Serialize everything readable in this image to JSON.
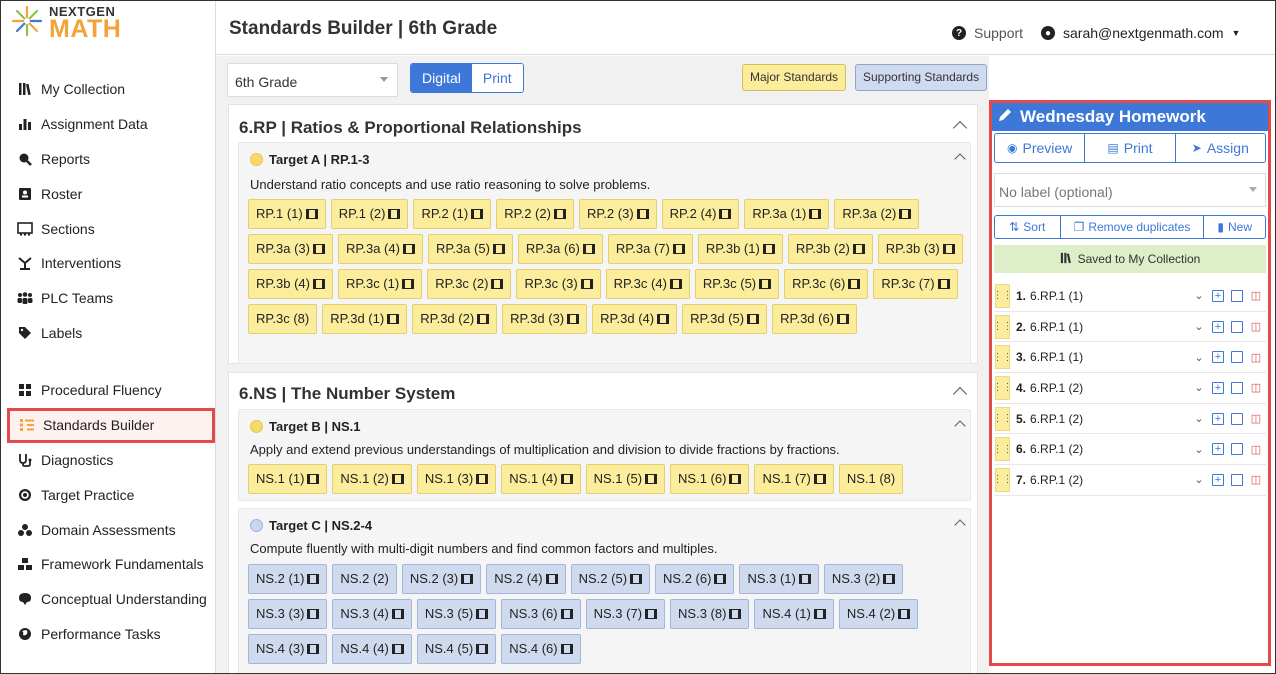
{
  "logo": {
    "line1": "NEXTGEN",
    "line2": "MATH"
  },
  "sidebar": {
    "items": [
      {
        "label": "My Collection",
        "icon": "collection-icon"
      },
      {
        "label": "Assignment Data",
        "icon": "bar-chart-icon"
      },
      {
        "label": "Reports",
        "icon": "search-report-icon"
      },
      {
        "label": "Roster",
        "icon": "roster-icon"
      },
      {
        "label": "Sections",
        "icon": "sections-icon"
      },
      {
        "label": "Interventions",
        "icon": "interventions-icon"
      },
      {
        "label": "PLC Teams",
        "icon": "users-icon"
      },
      {
        "label": "Labels",
        "icon": "tag-icon"
      }
    ],
    "items2": [
      {
        "label": "Procedural Fluency",
        "icon": "grid-icon"
      },
      {
        "label": "Standards Builder",
        "icon": "builder-icon",
        "active": true
      },
      {
        "label": "Diagnostics",
        "icon": "diagnostics-icon"
      },
      {
        "label": "Target Practice",
        "icon": "target-icon"
      },
      {
        "label": "Domain Assessments",
        "icon": "domain-icon"
      },
      {
        "label": "Framework Fundamentals",
        "icon": "framework-icon"
      },
      {
        "label": "Conceptual Understanding",
        "icon": "brain-icon"
      },
      {
        "label": "Performance Tasks",
        "icon": "globe-icon"
      }
    ]
  },
  "header": {
    "title": "Standards Builder | 6th Grade",
    "support": "Support",
    "user": "sarah@nextgenmath.com"
  },
  "toolbar": {
    "grade": "6th Grade",
    "mode_digital": "Digital",
    "mode_print": "Print",
    "legend_major": "Major Standards",
    "legend_supporting": "Supporting Standards"
  },
  "domains": [
    {
      "title": "6.RP | Ratios & Proportional Relationships",
      "targets": [
        {
          "head": "Target A | RP.1-3",
          "type": "major",
          "desc": "Understand ratio concepts and use ratio reasoning to solve problems.",
          "chips": [
            {
              "t": "RP.1 (1)",
              "v": true
            },
            {
              "t": "RP.1 (2)",
              "v": true
            },
            {
              "t": "RP.2 (1)",
              "v": true
            },
            {
              "t": "RP.2 (2)",
              "v": true
            },
            {
              "t": "RP.2 (3)",
              "v": true
            },
            {
              "t": "RP.2 (4)",
              "v": true
            },
            {
              "t": "RP.3a (1)",
              "v": true
            },
            {
              "t": "RP.3a (2)",
              "v": true
            },
            {
              "t": "RP.3a (3)",
              "v": true
            },
            {
              "t": "RP.3a (4)",
              "v": true
            },
            {
              "t": "RP.3a (5)",
              "v": true
            },
            {
              "t": "RP.3a (6)",
              "v": true
            },
            {
              "t": "RP.3a (7)",
              "v": true
            },
            {
              "t": "RP.3b (1)",
              "v": true
            },
            {
              "t": "RP.3b (2)",
              "v": true
            },
            {
              "t": "RP.3b (3)",
              "v": true
            },
            {
              "t": "RP.3b (4)",
              "v": true
            },
            {
              "t": "RP.3c (1)",
              "v": true
            },
            {
              "t": "RP.3c (2)",
              "v": true
            },
            {
              "t": "RP.3c (3)",
              "v": true
            },
            {
              "t": "RP.3c (4)",
              "v": true
            },
            {
              "t": "RP.3c (5)",
              "v": true
            },
            {
              "t": "RP.3c (6)",
              "v": true
            },
            {
              "t": "RP.3c (7)",
              "v": true
            },
            {
              "t": "RP.3c (8)",
              "v": false
            },
            {
              "t": "RP.3d (1)",
              "v": true
            },
            {
              "t": "RP.3d (2)",
              "v": true
            },
            {
              "t": "RP.3d (3)",
              "v": true
            },
            {
              "t": "RP.3d (4)",
              "v": true
            },
            {
              "t": "RP.3d (5)",
              "v": true
            },
            {
              "t": "RP.3d (6)",
              "v": true
            }
          ]
        }
      ]
    },
    {
      "title": "6.NS | The Number System",
      "targets": [
        {
          "head": "Target B | NS.1",
          "type": "major",
          "desc": "Apply and extend previous understandings of multiplication and division to divide fractions by fractions.",
          "chips": [
            {
              "t": "NS.1 (1)",
              "v": true
            },
            {
              "t": "NS.1 (2)",
              "v": true
            },
            {
              "t": "NS.1 (3)",
              "v": true
            },
            {
              "t": "NS.1 (4)",
              "v": true
            },
            {
              "t": "NS.1 (5)",
              "v": true
            },
            {
              "t": "NS.1 (6)",
              "v": true
            },
            {
              "t": "NS.1 (7)",
              "v": true
            },
            {
              "t": "NS.1 (8)",
              "v": false
            }
          ]
        },
        {
          "head": "Target C | NS.2-4",
          "type": "support",
          "desc": "Compute fluently with multi-digit numbers and find common factors and multiples.",
          "chips": [
            {
              "t": "NS.2 (1)",
              "v": true
            },
            {
              "t": "NS.2 (2)",
              "v": false
            },
            {
              "t": "NS.2 (3)",
              "v": true
            },
            {
              "t": "NS.2 (4)",
              "v": true
            },
            {
              "t": "NS.2 (5)",
              "v": true
            },
            {
              "t": "NS.2 (6)",
              "v": true
            },
            {
              "t": "NS.3 (1)",
              "v": true
            },
            {
              "t": "NS.3 (2)",
              "v": true
            },
            {
              "t": "NS.3 (3)",
              "v": true
            },
            {
              "t": "NS.3 (4)",
              "v": true
            },
            {
              "t": "NS.3 (5)",
              "v": true
            },
            {
              "t": "NS.3 (6)",
              "v": true
            },
            {
              "t": "NS.3 (7)",
              "v": true
            },
            {
              "t": "NS.3 (8)",
              "v": true
            },
            {
              "t": "NS.4 (1)",
              "v": true
            },
            {
              "t": "NS.4 (2)",
              "v": true
            },
            {
              "t": "NS.4 (3)",
              "v": true
            },
            {
              "t": "NS.4 (4)",
              "v": true
            },
            {
              "t": "NS.4 (5)",
              "v": true
            },
            {
              "t": "NS.4 (6)",
              "v": true
            }
          ]
        }
      ]
    }
  ],
  "panel": {
    "title": "Wednesday Homework",
    "preview": "Preview",
    "print": "Print",
    "assign": "Assign",
    "label_placeholder": "No label (optional)",
    "sort": "Sort",
    "remove_duplicates": "Remove duplicates",
    "new": "New",
    "saved": "Saved to My Collection",
    "items": [
      {
        "num": "1.",
        "label": "6.RP.1 (1)"
      },
      {
        "num": "2.",
        "label": "6.RP.1 (1)"
      },
      {
        "num": "3.",
        "label": "6.RP.1 (1)"
      },
      {
        "num": "4.",
        "label": "6.RP.1 (2)"
      },
      {
        "num": "5.",
        "label": "6.RP.1 (2)"
      },
      {
        "num": "6.",
        "label": "6.RP.1 (2)"
      },
      {
        "num": "7.",
        "label": "6.RP.1 (2)"
      }
    ]
  }
}
